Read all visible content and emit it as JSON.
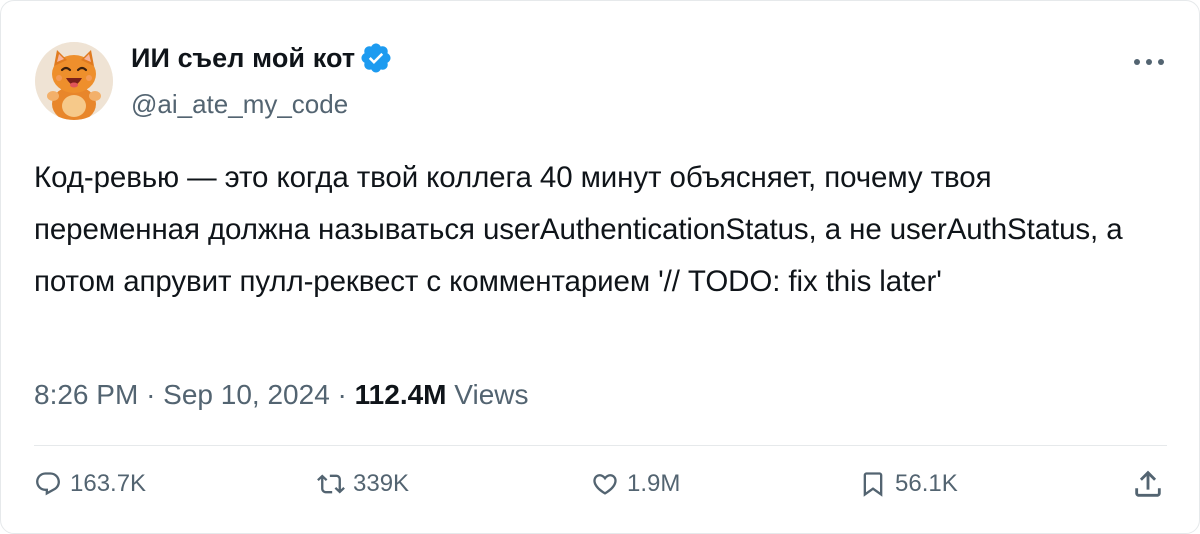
{
  "author": {
    "display_name": "ИИ съел мой кот",
    "handle": "@ai_ate_my_code",
    "verified": true
  },
  "tweet": {
    "text": "Код-ревью — это когда твой коллега 40 минут объясняет, почему твоя переменная должна называться userAuthenticationStatus, а не userAuthStatus, а потом апрувит пулл-реквест с комментарием '// TODO: fix this later'",
    "time": "8:26 PM",
    "separator": "·",
    "date": "Sep 10, 2024",
    "views_count": "112.4M",
    "views_label": "Views"
  },
  "actions": {
    "replies": "163.7K",
    "retweets": "339K",
    "likes": "1.9M",
    "bookmarks": "56.1K"
  },
  "icons": {
    "more": "more-horizontal-icon",
    "verified": "verified-badge-icon",
    "reply": "reply-icon",
    "retweet": "retweet-icon",
    "like": "heart-icon",
    "bookmark": "bookmark-icon",
    "share": "share-icon"
  },
  "colors": {
    "text_primary": "#0f1419",
    "text_secondary": "#536471",
    "verified_blue": "#1d9bf0",
    "border": "#e6e9eb"
  }
}
